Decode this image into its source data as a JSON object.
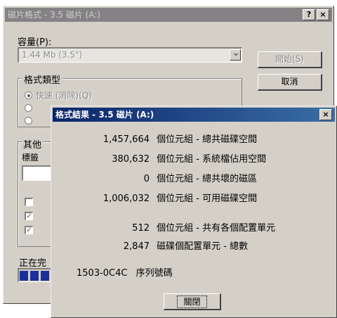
{
  "format_dialog": {
    "title": "磁片格式 - 3.5 磁片 (A:)",
    "help_label": "?",
    "close_label": "×",
    "capacity_label": "容量(P):",
    "capacity_value": "1.44 Mb (3.5\")",
    "start_button": "開始(S)",
    "cancel_button": "取消",
    "format_type_label": "格式類型",
    "radio_quick": "快速 (消除)(Q)",
    "other_label": "其他",
    "label_field_label": "標籤",
    "checkbox_marks": [
      "",
      "✓",
      "✓"
    ],
    "progress_label": "正在完",
    "progress": {
      "blocks_filled": 3
    }
  },
  "results_dialog": {
    "title": "格式結果 - 3.5 磁片 (A:)",
    "close_label": "×",
    "rows": [
      {
        "value": "1,457,664",
        "text": "個位元組 - 總共磁碟空間"
      },
      {
        "value": "380,632",
        "text": "個位元組 - 系統檔佔用空間"
      },
      {
        "value": "0",
        "text": "個位元組 - 總共壞的磁區"
      },
      {
        "value": "1,006,032",
        "text": "個位元組 - 可用磁碟空間"
      },
      {
        "value": "512",
        "text": "個位元組 - 共有各個配置單元"
      },
      {
        "value": "2,847",
        "text": "磁碟個配置單元 - 總數"
      }
    ],
    "serial_value": "1503-0C4C",
    "serial_label": "序列號碼",
    "close_button": "關閉"
  },
  "colors": {
    "dialog_bg": "#d4d0c8",
    "active_title": "#0a246a",
    "inactive_title": "#848284",
    "progress_fill": "#1a2f9a"
  }
}
